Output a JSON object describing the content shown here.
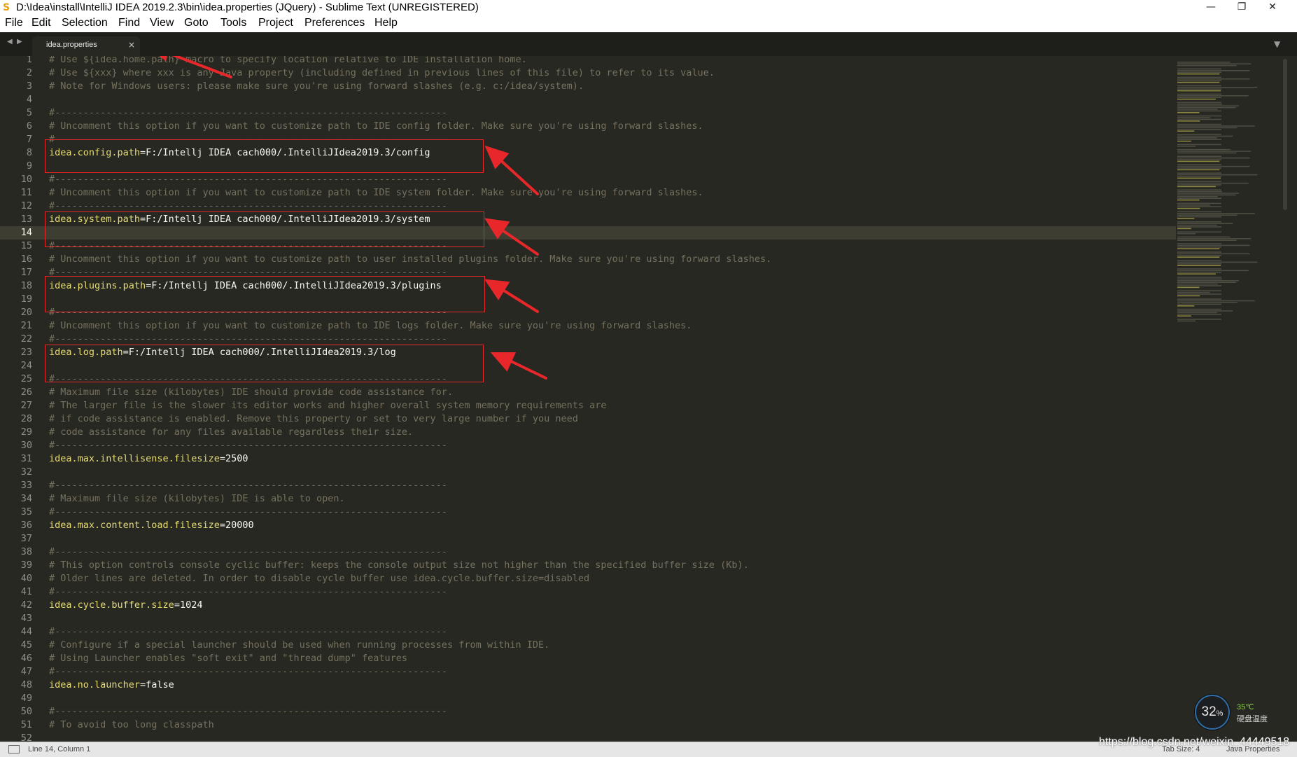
{
  "window": {
    "title": "D:\\Idea\\install\\IntelliJ IDEA 2019.2.3\\bin\\idea.properties (JQuery) - Sublime Text (UNREGISTERED)",
    "app_icon": "sublime-text-icon",
    "controls": {
      "minimize": "—",
      "maximize": "❐",
      "close": "✕"
    }
  },
  "menu": [
    "File",
    "Edit",
    "Selection",
    "Find",
    "View",
    "Goto",
    "Tools",
    "Project",
    "Preferences",
    "Help"
  ],
  "tabs": {
    "nav_back": "◀",
    "nav_forward": "▶",
    "active": {
      "label": "idea.properties",
      "close": "×"
    },
    "dropdown": "▼"
  },
  "editor": {
    "current_line": 14,
    "colors": {
      "background": "#272822",
      "comment": "#75715e",
      "key": "#e6db74",
      "value": "#f8f8f2",
      "gutter": "#8f908a",
      "highlight": "#e8272b"
    },
    "lines": [
      {
        "n": "1",
        "comment": "# Use ${idea.home.path} macro to specify location relative to IDE installation home."
      },
      {
        "n": "2",
        "comment": "# Use ${xxx} where xxx is any Java property (including defined in previous lines of this file) to refer to its value."
      },
      {
        "n": "3",
        "comment": "# Note for Windows users: please make sure you're using forward slashes (e.g. c:/idea/system)."
      },
      {
        "n": "4"
      },
      {
        "n": "5",
        "comment": "#---------------------------------------------------------------------"
      },
      {
        "n": "6",
        "comment": "# Uncomment this option if you want to customize path to IDE config folder. Make sure you're using forward slashes."
      },
      {
        "n": "7",
        "comment": "#---------------------------------------------------------------------"
      },
      {
        "n": "8",
        "key": "idea.config.path",
        "value": "=F:/Intellj IDEA cach000/.IntelliJIdea2019.3/config"
      },
      {
        "n": "9"
      },
      {
        "n": "10",
        "comment": "#---------------------------------------------------------------------"
      },
      {
        "n": "11",
        "comment": "# Uncomment this option if you want to customize path to IDE system folder. Make sure you're using forward slashes."
      },
      {
        "n": "12",
        "comment": "#---------------------------------------------------------------------"
      },
      {
        "n": "13",
        "key": "idea.system.path",
        "value": "=F:/Intellj IDEA cach000/.IntelliJIdea2019.3/system"
      },
      {
        "n": "14"
      },
      {
        "n": "15",
        "comment": "#---------------------------------------------------------------------"
      },
      {
        "n": "16",
        "comment": "# Uncomment this option if you want to customize path to user installed plugins folder. Make sure you're using forward slashes."
      },
      {
        "n": "17",
        "comment": "#---------------------------------------------------------------------"
      },
      {
        "n": "18",
        "key": "idea.plugins.path",
        "value": "=F:/Intellj IDEA cach000/.IntelliJIdea2019.3/plugins"
      },
      {
        "n": "19"
      },
      {
        "n": "20",
        "comment": "#---------------------------------------------------------------------"
      },
      {
        "n": "21",
        "comment": "# Uncomment this option if you want to customize path to IDE logs folder. Make sure you're using forward slashes."
      },
      {
        "n": "22",
        "comment": "#---------------------------------------------------------------------"
      },
      {
        "n": "23",
        "key": "idea.log.path",
        "value": "=F:/Intellj IDEA cach000/.IntelliJIdea2019.3/log"
      },
      {
        "n": "24"
      },
      {
        "n": "25",
        "comment": "#---------------------------------------------------------------------"
      },
      {
        "n": "26",
        "comment": "# Maximum file size (kilobytes) IDE should provide code assistance for."
      },
      {
        "n": "27",
        "comment": "# The larger file is the slower its editor works and higher overall system memory requirements are"
      },
      {
        "n": "28",
        "comment": "# if code assistance is enabled. Remove this property or set to very large number if you need"
      },
      {
        "n": "29",
        "comment": "# code assistance for any files available regardless their size."
      },
      {
        "n": "30",
        "comment": "#---------------------------------------------------------------------"
      },
      {
        "n": "31",
        "key": "idea.max.intellisense.filesize",
        "value": "=2500"
      },
      {
        "n": "32"
      },
      {
        "n": "33",
        "comment": "#---------------------------------------------------------------------"
      },
      {
        "n": "34",
        "comment": "# Maximum file size (kilobytes) IDE is able to open."
      },
      {
        "n": "35",
        "comment": "#---------------------------------------------------------------------"
      },
      {
        "n": "36",
        "key": "idea.max.content.load.filesize",
        "value": "=20000"
      },
      {
        "n": "37"
      },
      {
        "n": "38",
        "comment": "#---------------------------------------------------------------------"
      },
      {
        "n": "39",
        "comment": "# This option controls console cyclic buffer: keeps the console output size not higher than the specified buffer size (Kb)."
      },
      {
        "n": "40",
        "comment": "# Older lines are deleted. In order to disable cycle buffer use idea.cycle.buffer.size=disabled"
      },
      {
        "n": "41",
        "comment": "#---------------------------------------------------------------------"
      },
      {
        "n": "42",
        "key": "idea.cycle.buffer.size",
        "value": "=1024"
      },
      {
        "n": "43"
      },
      {
        "n": "44",
        "comment": "#---------------------------------------------------------------------"
      },
      {
        "n": "45",
        "comment": "# Configure if a special launcher should be used when running processes from within IDE."
      },
      {
        "n": "46",
        "comment": "# Using Launcher enables \"soft exit\" and \"thread dump\" features"
      },
      {
        "n": "47",
        "comment": "#---------------------------------------------------------------------"
      },
      {
        "n": "48",
        "key": "idea.no.launcher",
        "value": "=false"
      },
      {
        "n": "49"
      },
      {
        "n": "50",
        "comment": "#---------------------------------------------------------------------"
      },
      {
        "n": "51",
        "comment": "# To avoid too long classpath"
      },
      {
        "n": "52"
      }
    ]
  },
  "widget": {
    "percent": "32",
    "percent_sign": "%",
    "temperature": "35℃",
    "temperature_label": "硬盘温度"
  },
  "status": {
    "position": "Line 14, Column 1",
    "tab_size": "Tab Size: 4",
    "syntax": "Java Properties"
  },
  "watermark": "https://blog.csdn.net/weixin_44449518"
}
